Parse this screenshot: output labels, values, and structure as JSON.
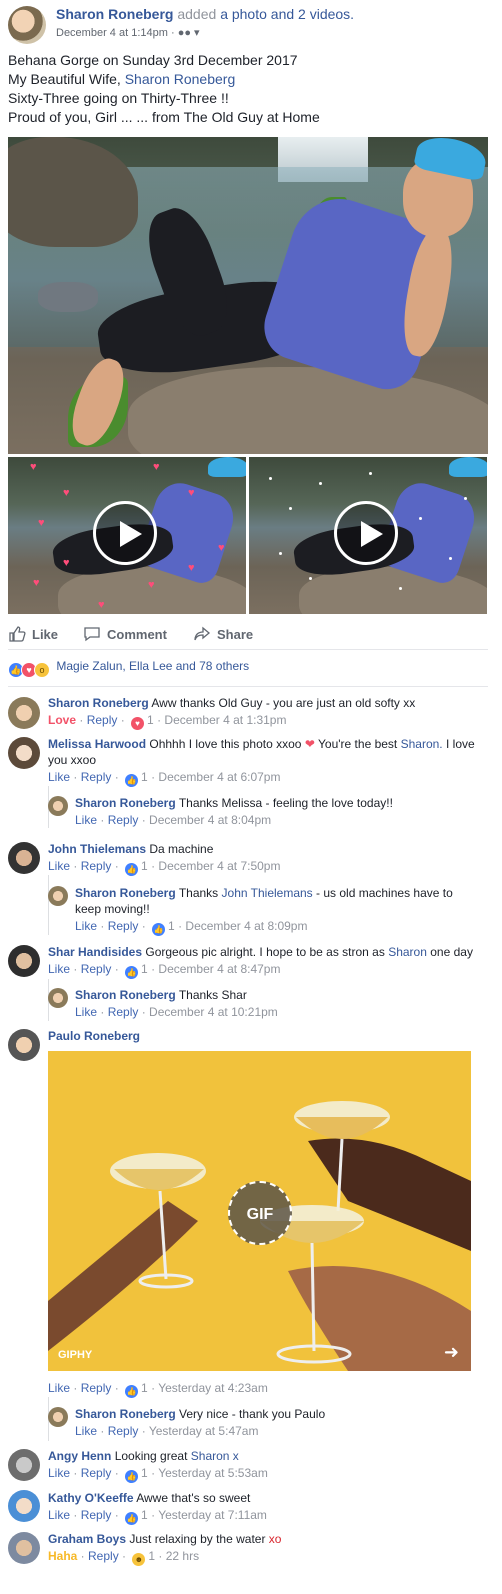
{
  "post": {
    "author": "Sharon Roneberg",
    "action": "added",
    "action_link": "a photo and 2 videos.",
    "timestamp": "December 4 at 1:14pm",
    "audience_icon": "friends-icon",
    "lines": [
      "Behana Gorge on Sunday 3rd December 2017",
      "My Beautiful Wife,",
      "Sixty-Three going on Thirty-Three !!",
      "Proud of you, Girl ... ... from The Old Guy at Home"
    ],
    "mention": "Sharon Roneberg"
  },
  "actions": {
    "like": "Like",
    "comment": "Comment",
    "share": "Share"
  },
  "reactions": {
    "summary": "Magie Zalun, Ella Lee and 78 others"
  },
  "comments": [
    {
      "author": "Sharon Roneberg",
      "text": "Aww thanks Old Guy - you are just an old softy xx",
      "reaction_label": "Love",
      "reply": "Reply",
      "count": "1",
      "time": "December 4 at 1:31pm"
    },
    {
      "author": "Melissa Harwood",
      "text_a": "Ohhhh I love this photo xxoo",
      "text_b": "You're the best",
      "mention": "Sharon.",
      "text_c": "I love you xxoo",
      "like": "Like",
      "reply": "Reply",
      "count": "1",
      "time": "December 4 at 6:07pm"
    },
    {
      "author": "Sharon Roneberg",
      "text": "Thanks Melissa - feeling the love today!!",
      "like": "Like",
      "reply": "Reply",
      "time": "December 4 at 8:04pm"
    },
    {
      "author": "John Thielemans",
      "text": "Da machine",
      "like": "Like",
      "reply": "Reply",
      "count": "1",
      "time": "December 4 at 7:50pm"
    },
    {
      "author": "Sharon Roneberg",
      "text_a": "Thanks",
      "mention": "John Thielemans",
      "text_b": "- us old machines have to keep moving!!",
      "like": "Like",
      "reply": "Reply",
      "count": "1",
      "time": "December 4 at 8:09pm"
    },
    {
      "author": "Shar Handisides",
      "text_a": "Gorgeous pic alright. I hope to be as stron as",
      "mention": "Sharon",
      "text_b": "one day",
      "like": "Like",
      "reply": "Reply",
      "count": "1",
      "time": "December 4 at 8:47pm"
    },
    {
      "author": "Sharon Roneberg",
      "text": "Thanks Shar",
      "like": "Like",
      "reply": "Reply",
      "time": "December 4 at 10:21pm"
    },
    {
      "author": "Paulo Roneberg",
      "gif_badge": "GIF",
      "gif_source": "GIPHY",
      "like": "Like",
      "reply": "Reply",
      "count": "1",
      "time": "Yesterday at 4:23am"
    },
    {
      "author": "Sharon Roneberg",
      "text": "Very nice - thank you Paulo",
      "like": "Like",
      "reply": "Reply",
      "time": "Yesterday at 5:47am"
    },
    {
      "author": "Angy Henn",
      "text_a": "Looking great",
      "mention": "Sharon x",
      "like": "Like",
      "reply": "Reply",
      "count": "1",
      "time": "Yesterday at 5:53am"
    },
    {
      "author": "Kathy O'Keeffe",
      "text": "Awwe that's so sweet",
      "like": "Like",
      "reply": "Reply",
      "count": "1",
      "time": "Yesterday at 7:11am"
    },
    {
      "author": "Graham Boys",
      "text_a": "Just relaxing by the water",
      "emph": "xo",
      "reaction_label": "Haha",
      "reply": "Reply",
      "count": "1",
      "time": "22 hrs"
    }
  ],
  "colors": {
    "link": "#365899",
    "love": "#f25268",
    "haha": "#f7b928",
    "like": "#4267b2"
  }
}
